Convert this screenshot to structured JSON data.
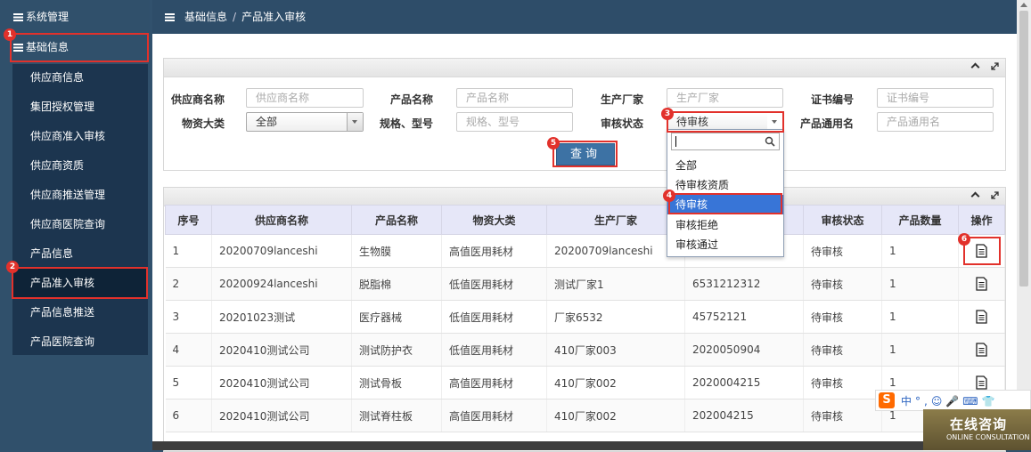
{
  "sidebar": {
    "top": [
      {
        "label": "系统管理"
      },
      {
        "label": "基础信息"
      }
    ],
    "items": [
      {
        "label": "供应商信息"
      },
      {
        "label": "集团授权管理"
      },
      {
        "label": "供应商准入审核"
      },
      {
        "label": "供应商资质"
      },
      {
        "label": "供应商推送管理"
      },
      {
        "label": "供应商医院查询"
      },
      {
        "label": "产品信息"
      },
      {
        "label": "产品准入审核"
      },
      {
        "label": "产品信息推送"
      },
      {
        "label": "产品医院查询"
      }
    ]
  },
  "header": {
    "crumb1": "基础信息",
    "sep": "/",
    "crumb2": "产品准入审核"
  },
  "search": {
    "supplier_label": "供应商名称",
    "supplier_placeholder": "供应商名称",
    "product_label": "产品名称",
    "product_placeholder": "产品名称",
    "maker_label": "生产厂家",
    "maker_placeholder": "生产厂家",
    "cert_label": "证书编号",
    "cert_placeholder": "证书编号",
    "category_label": "物资大类",
    "category_value": "全部",
    "spec_label": "规格、型号",
    "spec_placeholder": "规格、型号",
    "status_label": "审核状态",
    "status_value": "待审核",
    "generic_label": "产品通用名",
    "generic_placeholder": "产品通用名",
    "query_label": "查询"
  },
  "dropdown": {
    "options": [
      {
        "label": "全部"
      },
      {
        "label": "待审核资质"
      },
      {
        "label": "待审核"
      },
      {
        "label": "审核拒绝"
      },
      {
        "label": "审核通过"
      }
    ]
  },
  "table": {
    "headers": [
      "序号",
      "供应商名称",
      "产品名称",
      "物资大类",
      "生产厂家",
      "",
      "审核状态",
      "产品数量",
      "操作"
    ],
    "rows": [
      [
        "1",
        "20200709lanceshi",
        "生物膜",
        "高值医用耗材",
        "20200709lanceshi",
        "",
        "待审核",
        "1"
      ],
      [
        "2",
        "20200924lanceshi",
        "脱脂棉",
        "低值医用耗材",
        "测试厂家1",
        "6531212312",
        "待审核",
        "1"
      ],
      [
        "3",
        "20201023测试",
        "医疗器械",
        "低值医用耗材",
        "厂家6532",
        "45752121",
        "待审核",
        "1"
      ],
      [
        "4",
        "2020410测试公司",
        "测试防护衣",
        "低值医用耗材",
        "410厂家003",
        "2020050904",
        "待审核",
        "1"
      ],
      [
        "5",
        "2020410测试公司",
        "测试骨板",
        "高值医用耗材",
        "410厂家002",
        "2020004215",
        "待审核",
        "1"
      ],
      [
        "6",
        "2020410测试公司",
        "测试脊柱板",
        "高值医用耗材",
        "410厂家002",
        "202004215",
        "待审核",
        "1"
      ]
    ]
  },
  "badges": [
    "1",
    "2",
    "3",
    "4",
    "5",
    "6"
  ],
  "ime": {
    "logo": "S",
    "text": "中°,☺🎤⌨👕"
  },
  "consult": {
    "title": "在线咨询",
    "subtitle": "ONLINE CONSULTATION"
  },
  "colors": {
    "sidebar": "#30506b",
    "accent": "#3d72a4",
    "annotation": "#e2312b",
    "highlight": "#3875d7"
  }
}
